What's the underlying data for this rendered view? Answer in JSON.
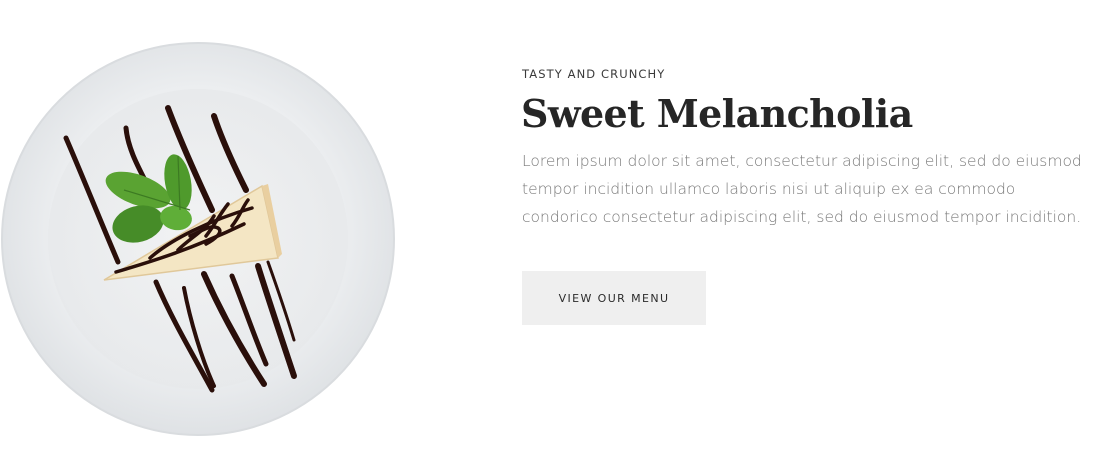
{
  "hero": {
    "eyebrow": "TASTY AND CRUNCHY",
    "title": "Sweet Melancholia",
    "description": "Lorem ipsum dolor sit amet, consectetur adipiscing elit, sed do eiusmod tempor incidition ullamco laboris nisi ut aliquip ex ea commodo condorico consectetur adipiscing elit, sed do eiusmod tempor incidition.",
    "button_label": "VIEW OUR MENU",
    "image_subject": "dessert-plate-image"
  },
  "colors": {
    "background": "#ffffff",
    "title": "#262626",
    "body_text": "#7a7a7a",
    "button_bg": "#efefef",
    "chocolate": "#2a0f0a",
    "mint": "#4f9a2c"
  }
}
